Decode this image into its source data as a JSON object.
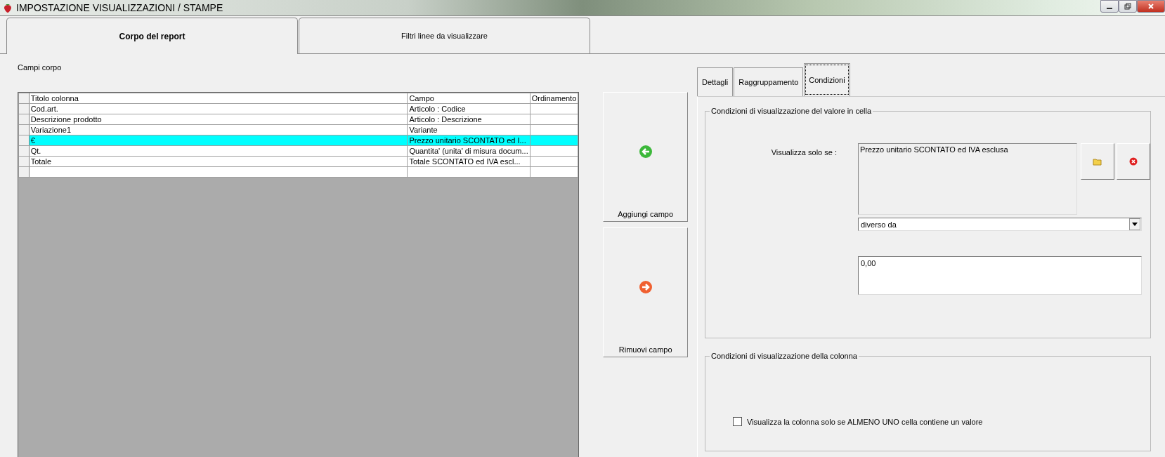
{
  "window": {
    "title": "IMPOSTAZIONE VISUALIZZAZIONI / STAMPE"
  },
  "main_tabs": [
    {
      "label": "Corpo del report",
      "selected": true
    },
    {
      "label": "Filtri linee da visualizzare",
      "selected": false
    }
  ],
  "section_label": "Campi corpo",
  "table": {
    "columns": [
      "Titolo colonna",
      "Campo",
      "Ordinamento"
    ],
    "rows": [
      {
        "cells": [
          "Cod.art.",
          "Articolo : Codice",
          ""
        ],
        "selected": false
      },
      {
        "cells": [
          "Descrizione prodotto",
          "Articolo : Descrizione",
          ""
        ],
        "selected": false
      },
      {
        "cells": [
          "Variazione1",
          "Variante",
          ""
        ],
        "selected": false
      },
      {
        "cells": [
          "€",
          "Prezzo unitario SCONTATO ed I...",
          ""
        ],
        "selected": true
      },
      {
        "cells": [
          "Qt.",
          "Quantita' (unita' di misura docum...",
          ""
        ],
        "selected": false
      },
      {
        "cells": [
          "Totale",
          "Totale SCONTATO ed IVA escl...",
          ""
        ],
        "selected": false
      }
    ]
  },
  "actions": [
    {
      "label": "Aggiungi campo",
      "kind": "add"
    },
    {
      "label": "Rimuovi campo",
      "kind": "remove"
    }
  ],
  "sub_tabs": [
    {
      "label": "Dettagli",
      "selected": false
    },
    {
      "label": "Raggruppamento",
      "selected": false
    },
    {
      "label": "Condizioni",
      "selected": true
    }
  ],
  "cell_group": {
    "title": "Condizioni di visualizzazione del valore in cella",
    "label": "Visualizza solo se :",
    "field_value": "Prezzo unitario SCONTATO ed IVA esclusa",
    "operator": "diverso da",
    "compare_value": "0,00"
  },
  "column_group": {
    "title": "Condizioni di visualizzazione della colonna",
    "checkbox": {
      "label": "Visualizza la colonna solo se ALMENO UNO cella contiene un valore",
      "checked": false
    }
  }
}
